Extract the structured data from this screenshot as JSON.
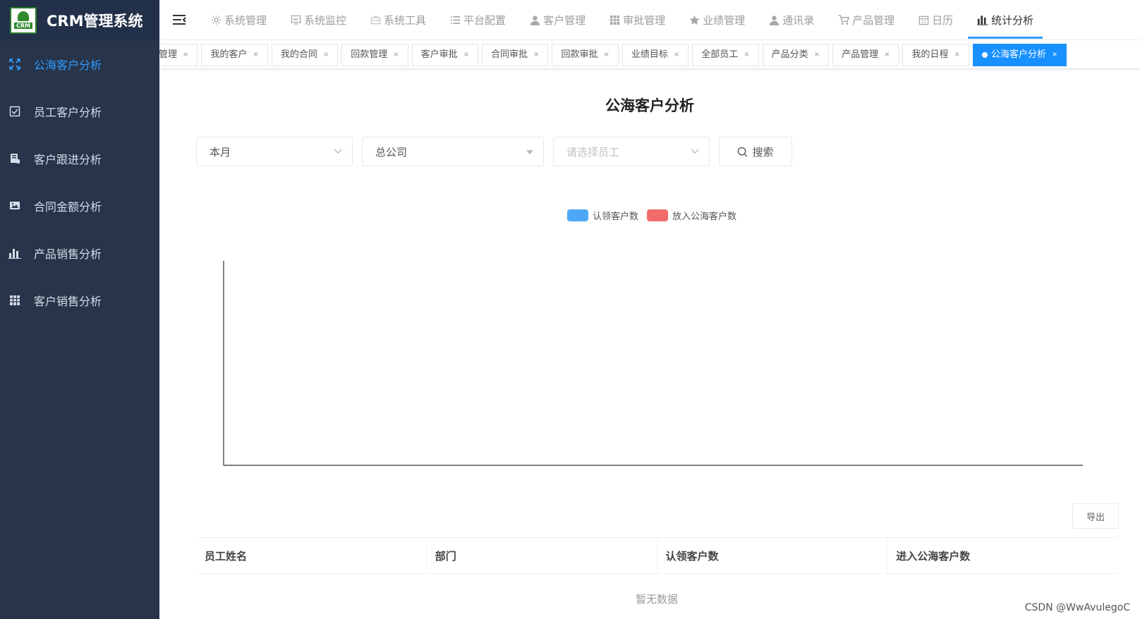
{
  "app": {
    "title": "CRM管理系统",
    "logo_text": "CRM"
  },
  "sidebar": {
    "items": [
      {
        "label": "公海客户分析",
        "icon": "expand-icon",
        "active": true
      },
      {
        "label": "员工客户分析",
        "icon": "checkbox-icon",
        "active": false
      },
      {
        "label": "客户跟进分析",
        "icon": "document-icon",
        "active": false
      },
      {
        "label": "合同金额分析",
        "icon": "image-card-icon",
        "active": false
      },
      {
        "label": "产品销售分析",
        "icon": "bar-chart-icon",
        "active": false
      },
      {
        "label": "客户销售分析",
        "icon": "table-icon",
        "active": false
      }
    ]
  },
  "topnav": {
    "items": [
      {
        "label": "系统管理",
        "icon": "gear-icon",
        "active": false
      },
      {
        "label": "系统监控",
        "icon": "monitor-icon",
        "active": false
      },
      {
        "label": "系统工具",
        "icon": "toolbox-icon",
        "active": false
      },
      {
        "label": "平台配置",
        "icon": "list-icon",
        "active": false
      },
      {
        "label": "客户管理",
        "icon": "user-icon",
        "active": false
      },
      {
        "label": "审批管理",
        "icon": "grid-icon",
        "active": false
      },
      {
        "label": "业绩管理",
        "icon": "star-icon",
        "active": false
      },
      {
        "label": "通讯录",
        "icon": "user-icon",
        "active": false
      },
      {
        "label": "产品管理",
        "icon": "cart-icon",
        "active": false
      },
      {
        "label": "日历",
        "icon": "calendar-icon",
        "active": false
      },
      {
        "label": "统计分析",
        "icon": "bar-chart-icon",
        "active": true
      }
    ]
  },
  "tags": [
    {
      "label": "管理",
      "active": false
    },
    {
      "label": "我的客户",
      "active": false
    },
    {
      "label": "我的合同",
      "active": false
    },
    {
      "label": "回款管理",
      "active": false
    },
    {
      "label": "客户审批",
      "active": false
    },
    {
      "label": "合同审批",
      "active": false
    },
    {
      "label": "回款审批",
      "active": false
    },
    {
      "label": "业绩目标",
      "active": false
    },
    {
      "label": "全部员工",
      "active": false
    },
    {
      "label": "产品分类",
      "active": false
    },
    {
      "label": "产品管理",
      "active": false
    },
    {
      "label": "我的日程",
      "active": false
    },
    {
      "label": "公海客户分析",
      "active": true
    }
  ],
  "tag_close": "×",
  "page": {
    "title": "公海客户分析"
  },
  "filters": {
    "period": "本月",
    "company": "总公司",
    "employee_placeholder": "请选择员工",
    "search_label": "搜索"
  },
  "chart_data": {
    "type": "bar",
    "categories": [],
    "series": [
      {
        "name": "认领客户数",
        "color": "#4ea7f5",
        "values": []
      },
      {
        "name": "放入公海客户数",
        "color": "#f26b6b",
        "values": []
      }
    ],
    "legend": "top-center"
  },
  "export_label": "导出",
  "table": {
    "columns": [
      "员工姓名",
      "部门",
      "认领客户数",
      "进入公海客户数"
    ],
    "rows": [],
    "empty_text": "暂无数据"
  },
  "watermark": "CSDN @WwAvulegoC"
}
